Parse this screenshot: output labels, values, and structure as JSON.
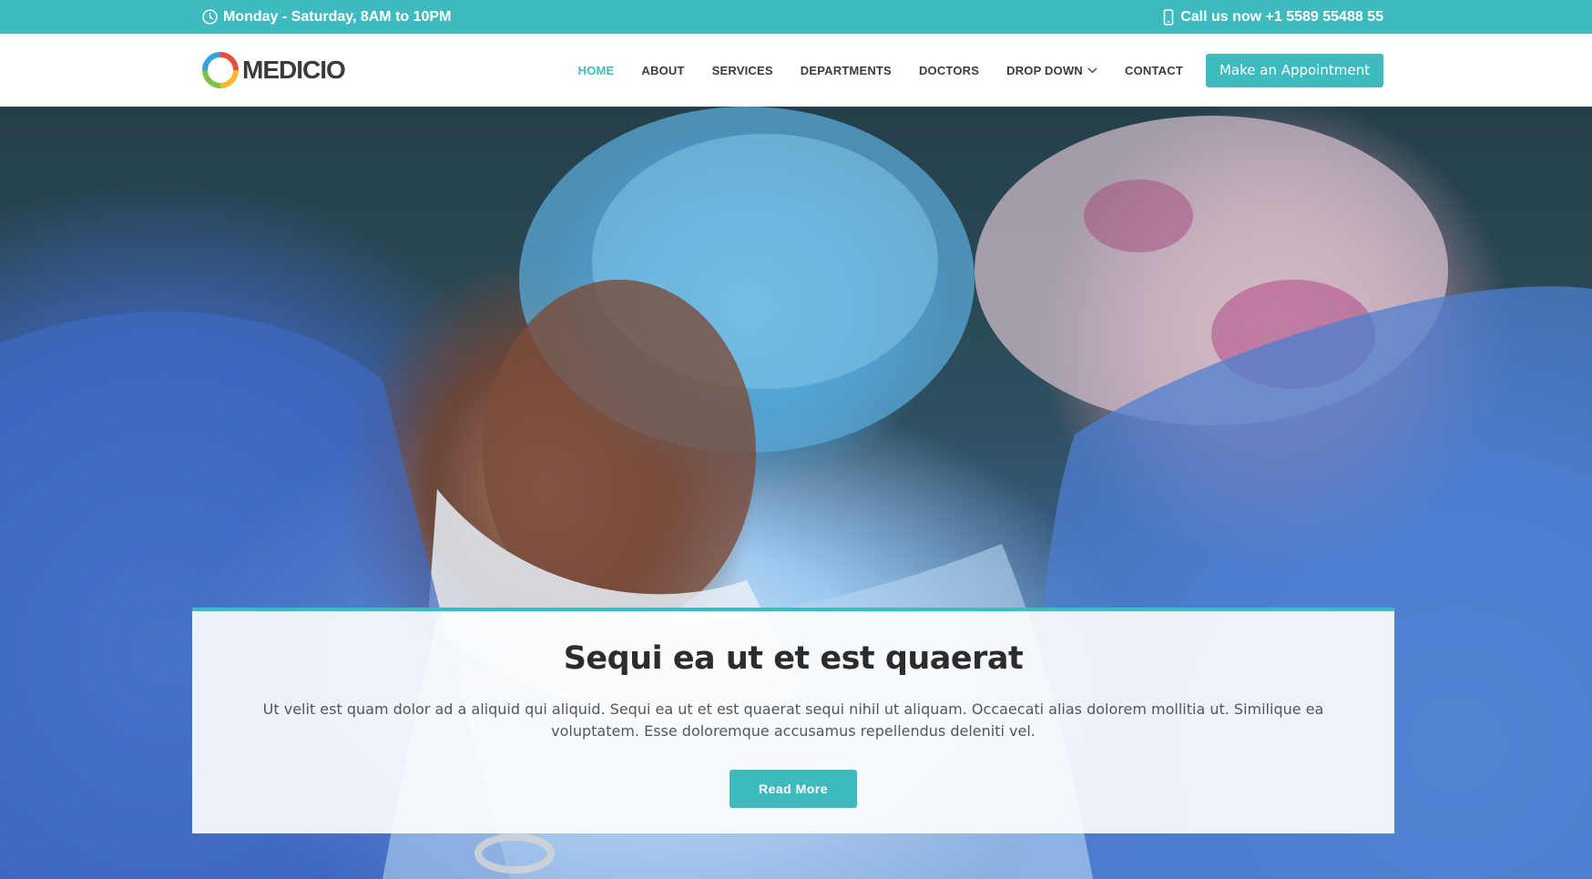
{
  "topbar": {
    "hours": "Monday - Saturday, 8AM to 10PM",
    "phone": "Call us now +1 5589 55488 55"
  },
  "header": {
    "logo_text": "MEDICIO",
    "nav": [
      {
        "label": "HOME",
        "active": true
      },
      {
        "label": "ABOUT"
      },
      {
        "label": "SERVICES"
      },
      {
        "label": "DEPARTMENTS"
      },
      {
        "label": "DOCTORS"
      },
      {
        "label": "DROP DOWN"
      },
      {
        "label": "CONTACT"
      }
    ],
    "cta_label": "Make an Appointment"
  },
  "hero": {
    "title": "Sequi ea ut et est quaerat",
    "text": "Ut velit est quam dolor ad a aliquid qui aliquid. Sequi ea ut et est quaerat sequi nihil ut aliquam. Occaecati alias dolorem mollitia ut. Similique ea voluptatem. Esse doloremque accusamus repellendus deleniti vel.",
    "button_label": "Read More"
  },
  "colors": {
    "accent": "#3fbbc0",
    "text_dark": "#2c2c2c",
    "nav_text": "#3b3b3b"
  },
  "icons": {
    "hours": "clock-icon",
    "phone": "phone-icon",
    "dropdown": "chevron-down-icon"
  }
}
